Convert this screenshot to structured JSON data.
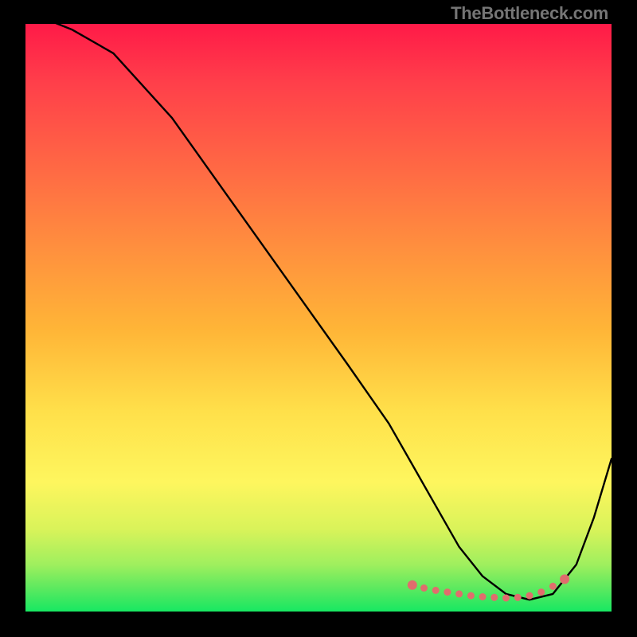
{
  "watermark": "TheBottleneck.com",
  "chart_data": {
    "type": "line",
    "title": "",
    "xlabel": "",
    "ylabel": "",
    "xlim": [
      0,
      100
    ],
    "ylim": [
      0,
      100
    ],
    "series": [
      {
        "name": "bottleneck-curve",
        "x": [
          0,
          3,
          8,
          15,
          25,
          35,
          45,
          55,
          62,
          66,
          70,
          74,
          78,
          82,
          86,
          90,
          94,
          97,
          100
        ],
        "values": [
          103,
          101,
          99,
          95,
          84,
          70,
          56,
          42,
          32,
          25,
          18,
          11,
          6,
          3,
          2,
          3,
          8,
          16,
          26
        ]
      },
      {
        "name": "optimal-range-dots",
        "x": [
          66,
          68,
          70,
          72,
          74,
          76,
          78,
          80,
          82,
          84,
          86,
          88,
          90,
          92
        ],
        "values": [
          4.5,
          4.0,
          3.6,
          3.3,
          3.0,
          2.7,
          2.5,
          2.4,
          2.3,
          2.4,
          2.7,
          3.3,
          4.3,
          5.5
        ]
      }
    ],
    "colors": {
      "curve": "#000000",
      "dots": "#e06d6d",
      "gradient_top": "#ff1a48",
      "gradient_bottom": "#17e862"
    }
  }
}
